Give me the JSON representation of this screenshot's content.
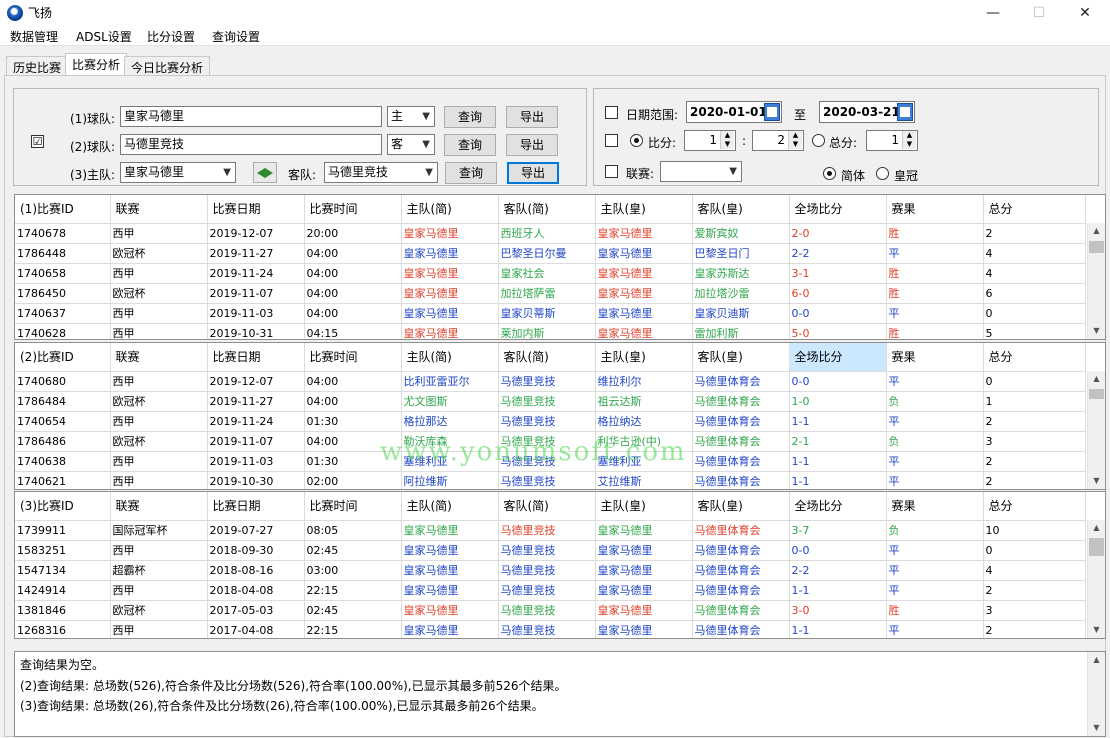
{
  "window": {
    "title": "飞扬",
    "minimize": "—",
    "maximize": "☐",
    "close": "✕"
  },
  "menu": [
    "数据管理",
    "ADSL设置",
    "比分设置",
    "查询设置"
  ],
  "tabs": [
    "历史比赛",
    "比赛分析",
    "今日比赛分析"
  ],
  "filters": {
    "enable_check": "☑",
    "row1": {
      "label": "(1)球队:",
      "team": "皇家马德里",
      "side": "主",
      "query": "查询",
      "export": "导出"
    },
    "row2": {
      "label": "(2)球队:",
      "team": "马德里竞技",
      "side": "客",
      "query": "查询",
      "export": "导出"
    },
    "row3": {
      "home_label": "(3)主队:",
      "home": "皇家马德里",
      "away_label": "客队:",
      "away": "马德里竞技",
      "query": "查询",
      "export": "导出"
    }
  },
  "options": {
    "date_label": "日期范围:",
    "date_from": "2020-01-01",
    "date_to_label": "至",
    "date_to": "2020-03-21",
    "score_label": "比分:",
    "score_home": "1",
    "score_sep": ":",
    "score_away": "2",
    "total_label": "总分:",
    "total": "1",
    "league_label": "联赛:",
    "league": "",
    "simplified": "简体",
    "crown": "皇冠"
  },
  "columns1": [
    "(1)比赛ID",
    "联赛",
    "比赛日期",
    "比赛时间",
    "主队(简)",
    "客队(简)",
    "主队(皇)",
    "客队(皇)",
    "全场比分",
    "赛果",
    "总分"
  ],
  "columns2": [
    "(2)比赛ID",
    "联赛",
    "比赛日期",
    "比赛时间",
    "主队(简)",
    "客队(简)",
    "主队(皇)",
    "客队(皇)",
    "全场比分",
    "赛果",
    "总分"
  ],
  "columns3": [
    "(3)比赛ID",
    "联赛",
    "比赛日期",
    "比赛时间",
    "主队(简)",
    "客队(简)",
    "主队(皇)",
    "客队(皇)",
    "全场比分",
    "赛果",
    "总分"
  ],
  "grid1": [
    [
      "1740678",
      "西甲",
      "2019-12-07",
      "20:00",
      "皇家马德里",
      "西班牙人",
      "皇家马德里",
      "爱斯宾奴",
      "2-0",
      "胜",
      "2"
    ],
    [
      "1786448",
      "欧冠杯",
      "2019-11-27",
      "04:00",
      "皇家马德里",
      "巴黎圣日尔曼",
      "皇家马德里",
      "巴黎圣日门",
      "2-2",
      "平",
      "4"
    ],
    [
      "1740658",
      "西甲",
      "2019-11-24",
      "04:00",
      "皇家马德里",
      "皇家社会",
      "皇家马德里",
      "皇家苏斯达",
      "3-1",
      "胜",
      "4"
    ],
    [
      "1786450",
      "欧冠杯",
      "2019-11-07",
      "04:00",
      "皇家马德里",
      "加拉塔萨雷",
      "皇家马德里",
      "加拉塔沙雷",
      "6-0",
      "胜",
      "6"
    ],
    [
      "1740637",
      "西甲",
      "2019-11-03",
      "04:00",
      "皇家马德里",
      "皇家贝蒂斯",
      "皇家马德里",
      "皇家贝迪斯",
      "0-0",
      "平",
      "0"
    ],
    [
      "1740628",
      "西甲",
      "2019-10-31",
      "04:15",
      "皇家马德里",
      "莱加内斯",
      "皇家马德里",
      "雷加利斯",
      "5-0",
      "胜",
      "5"
    ]
  ],
  "grid2": [
    [
      "1740680",
      "西甲",
      "2019-12-07",
      "04:00",
      "比利亚雷亚尔",
      "马德里竞技",
      "维拉利尔",
      "马德里体育会",
      "0-0",
      "平",
      "0"
    ],
    [
      "1786484",
      "欧冠杯",
      "2019-11-27",
      "04:00",
      "尤文图斯",
      "马德里竞技",
      "祖云达斯",
      "马德里体育会",
      "1-0",
      "负",
      "1"
    ],
    [
      "1740654",
      "西甲",
      "2019-11-24",
      "01:30",
      "格拉那达",
      "马德里竞技",
      "格拉纳达",
      "马德里体育会",
      "1-1",
      "平",
      "2"
    ],
    [
      "1786486",
      "欧冠杯",
      "2019-11-07",
      "04:00",
      "勒沃库森",
      "马德里竞技",
      "利华古逊(中)",
      "马德里体育会",
      "2-1",
      "负",
      "3"
    ],
    [
      "1740638",
      "西甲",
      "2019-11-03",
      "01:30",
      "塞维利亚",
      "马德里竞技",
      "塞维利亚",
      "马德里体育会",
      "1-1",
      "平",
      "2"
    ],
    [
      "1740621",
      "西甲",
      "2019-10-30",
      "02:00",
      "阿拉维斯",
      "马德里竞技",
      "艾拉维斯",
      "马德里体育会",
      "1-1",
      "平",
      "2"
    ]
  ],
  "grid3": [
    [
      "1739911",
      "国际冠军杯",
      "2019-07-27",
      "08:05",
      "皇家马德里",
      "马德里竞技",
      "皇家马德里",
      "马德里体育会",
      "3-7",
      "负",
      "10"
    ],
    [
      "1583251",
      "西甲",
      "2018-09-30",
      "02:45",
      "皇家马德里",
      "马德里竞技",
      "皇家马德里",
      "马德里体育会",
      "0-0",
      "平",
      "0"
    ],
    [
      "1547134",
      "超霸杯",
      "2018-08-16",
      "03:00",
      "皇家马德里",
      "马德里竞技",
      "皇家马德里",
      "马德里体育会",
      "2-2",
      "平",
      "4"
    ],
    [
      "1424914",
      "西甲",
      "2018-04-08",
      "22:15",
      "皇家马德里",
      "马德里竞技",
      "皇家马德里",
      "马德里体育会",
      "1-1",
      "平",
      "2"
    ],
    [
      "1381846",
      "欧冠杯",
      "2017-05-03",
      "02:45",
      "皇家马德里",
      "马德里竞技",
      "皇家马德里",
      "马德里体育会",
      "3-0",
      "胜",
      "3"
    ],
    [
      "1268316",
      "西甲",
      "2017-04-08",
      "22:15",
      "皇家马德里",
      "马德里竞技",
      "皇家马德里",
      "马德里体育会",
      "1-1",
      "平",
      "2"
    ]
  ],
  "log": [
    "查询结果为空。",
    "(2)查询结果: 总场数(526),符合条件及比分场数(526),符合率(100.00%),已显示其最多前526个结果。",
    "(3)查询结果: 总场数(26),符合条件及比分场数(26),符合率(100.00%),已显示其最多前26个结果。"
  ],
  "watermark": "www.yonumsoft.com",
  "colors": {
    "win": "#e0402a",
    "draw": "#1f45c8",
    "lose": "#2fa64a",
    "header_highlight": "#cce8ff"
  }
}
